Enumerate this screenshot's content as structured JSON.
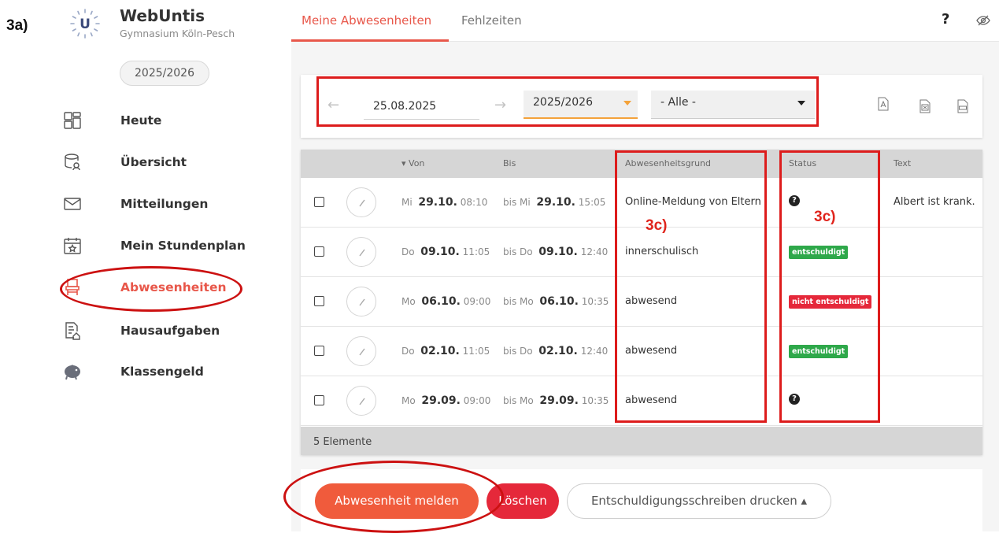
{
  "annotation": {
    "label": "3a)",
    "sublabel_a": "3c)",
    "sublabel_b": "3c)"
  },
  "brand": {
    "title": "WebUntis",
    "subtitle": "Gymnasium Köln-Pesch",
    "logo_letter": "U",
    "school_year": "2025/2026"
  },
  "sidebar": {
    "items": [
      {
        "label": "Heute",
        "icon": "dashboard-icon"
      },
      {
        "label": "Übersicht",
        "icon": "overview-icon"
      },
      {
        "label": "Mitteilungen",
        "icon": "mail-icon"
      },
      {
        "label": "Mein Stundenplan",
        "icon": "calendar-icon"
      },
      {
        "label": "Abwesenheiten",
        "icon": "chair-icon",
        "active": true
      },
      {
        "label": "Hausaufgaben",
        "icon": "homework-icon"
      },
      {
        "label": "Klassengeld",
        "icon": "piggy-bank-icon"
      }
    ]
  },
  "tabs": [
    {
      "label": "Meine Abwesenheiten",
      "active": true
    },
    {
      "label": "Fehlzeiten",
      "active": false
    }
  ],
  "header": {
    "help": "?"
  },
  "filters": {
    "date": "25.08.2025",
    "school_year": "2025/2026",
    "category": "- Alle -"
  },
  "exports": [
    "pdf-icon",
    "excel-icon",
    "csv-icon"
  ],
  "table": {
    "headers": {
      "von": "Von",
      "bis": "Bis",
      "grund": "Abwesenheitsgrund",
      "status": "Status",
      "text": "Text"
    },
    "rows": [
      {
        "von_day": "Mi",
        "von_date": "29.10.",
        "von_time": "08:10",
        "bis_prefix": "bis Mi",
        "bis_date": "29.10.",
        "bis_time": "15:05",
        "grund": "Online-Meldung von Eltern",
        "status": "",
        "text": "Albert ist krank."
      },
      {
        "von_day": "Do",
        "von_date": "09.10.",
        "von_time": "11:05",
        "bis_prefix": "bis Do",
        "bis_date": "09.10.",
        "bis_time": "12:40",
        "grund": "innerschulisch",
        "status": "entschuldigt",
        "text": ""
      },
      {
        "von_day": "Mo",
        "von_date": "06.10.",
        "von_time": "09:00",
        "bis_prefix": "bis Mo",
        "bis_date": "06.10.",
        "bis_time": "10:35",
        "grund": "abwesend",
        "status": "nicht entschuldigt",
        "text": ""
      },
      {
        "von_day": "Do",
        "von_date": "02.10.",
        "von_time": "11:05",
        "bis_prefix": "bis Do",
        "bis_date": "02.10.",
        "bis_time": "12:40",
        "grund": "abwesend",
        "status": "entschuldigt",
        "text": ""
      },
      {
        "von_day": "Mo",
        "von_date": "29.09.",
        "von_time": "09:00",
        "bis_prefix": "bis Mo",
        "bis_date": "29.09.",
        "bis_time": "10:35",
        "grund": "abwesend",
        "status": "",
        "text": ""
      }
    ],
    "footer": "5 Elemente"
  },
  "buttons": {
    "report": "Abwesenheit melden",
    "delete": "Löschen",
    "print": "Entschuldigungsschreiben drucken ▴"
  },
  "colors": {
    "accent": "#e8574a",
    "excused": "#2ea84a",
    "unexcused": "#e5283a",
    "annotation": "#dd1c1c"
  }
}
